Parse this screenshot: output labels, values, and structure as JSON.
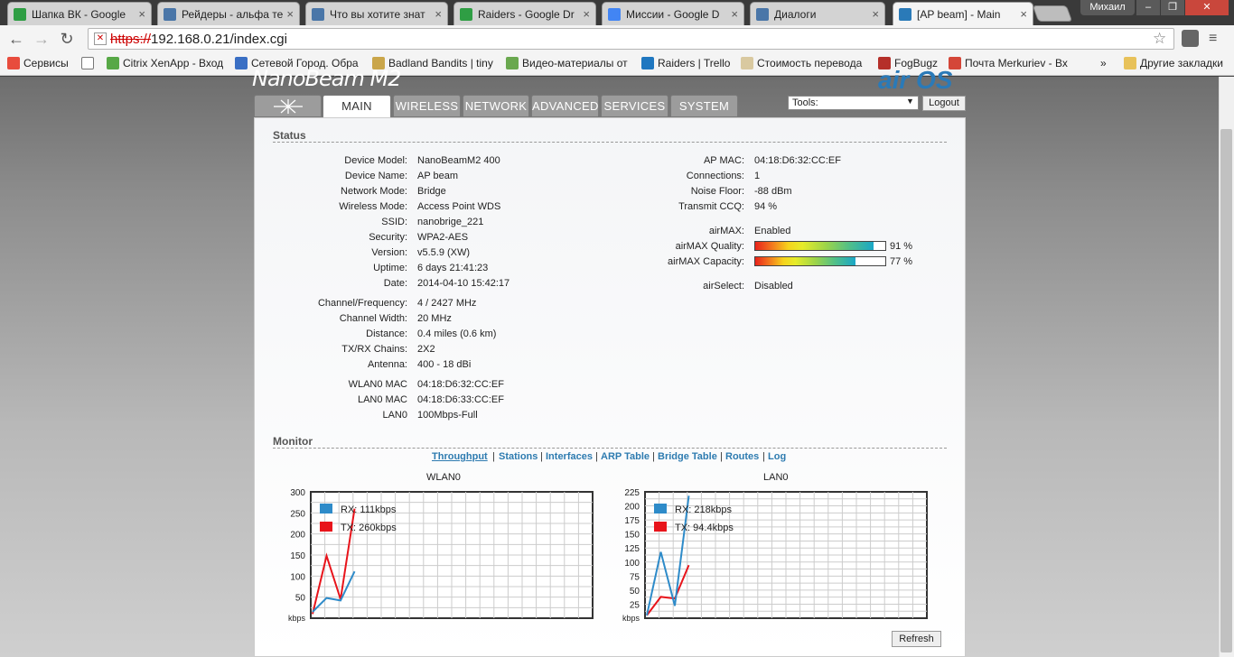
{
  "browser": {
    "tabs": [
      {
        "label": "Шапка ВК - Google",
        "icon": "google-drive-icon",
        "color": "#2f9e44"
      },
      {
        "label": "Рейдеры - альфа те",
        "icon": "vk-icon",
        "color": "#4a76a8"
      },
      {
        "label": "Что вы хотите знат",
        "icon": "vk-icon",
        "color": "#4a76a8"
      },
      {
        "label": "Raiders - Google Dr",
        "icon": "google-drive-icon",
        "color": "#2f9e44"
      },
      {
        "label": "Миссии - Google D",
        "icon": "google-docs-icon",
        "color": "#4285f4"
      },
      {
        "label": "Диалоги",
        "icon": "chat-icon",
        "color": "#4a76a8"
      },
      {
        "label": "[AP beam] - Main",
        "icon": "rss-icon",
        "color": "#2a7ab8"
      }
    ],
    "user": "Михаил",
    "url_scheme": "https://",
    "url_rest": "192.168.0.21/index.cgi",
    "bookmarks": [
      {
        "label": "Сервисы",
        "icon": "apps-icon"
      },
      {
        "label": "",
        "icon": "page-icon"
      },
      {
        "label": "Citrix XenApp - Вход",
        "icon": "citrix-icon"
      },
      {
        "label": "Сетевой Город. Обра",
        "icon": "network-city-icon"
      },
      {
        "label": "Badland Bandits | tiny",
        "icon": "badland-icon"
      },
      {
        "label": "Видео-материалы от",
        "icon": "h-icon"
      },
      {
        "label": "Raiders | Trello",
        "icon": "trello-icon"
      },
      {
        "label": "Стоимость перевода",
        "icon": "book-icon"
      },
      {
        "label": "FogBugz",
        "icon": "fogbugz-icon"
      },
      {
        "label": "Почта Merkuriev - Вх",
        "icon": "gmail-icon"
      }
    ],
    "bookmarks_more": "»",
    "other_bookmarks": "Другие закладки"
  },
  "device_ui": {
    "brand": "NanoBeam M2",
    "brand_right": "air OS",
    "tabs": [
      "MAIN",
      "WIRELESS",
      "NETWORK",
      "ADVANCED",
      "SERVICES",
      "SYSTEM"
    ],
    "tools_label": "Tools:",
    "logout": "Logout"
  },
  "status": {
    "title": "Status",
    "left": [
      {
        "label": "Device Model:",
        "value": "NanoBeamM2 400"
      },
      {
        "label": "Device Name:",
        "value": "AP beam"
      },
      {
        "label": "Network Mode:",
        "value": "Bridge"
      },
      {
        "label": "Wireless Mode:",
        "value": "Access Point WDS"
      },
      {
        "label": "SSID:",
        "value": "nanobrige_221"
      },
      {
        "label": "Security:",
        "value": "WPA2-AES"
      },
      {
        "label": "Version:",
        "value": "v5.5.9 (XW)"
      },
      {
        "label": "Uptime:",
        "value": "6 days 21:41:23"
      },
      {
        "label": "Date:",
        "value": "2014-04-10 15:42:17"
      },
      {
        "label": "Channel/Frequency:",
        "value": "4 / 2427 MHz"
      },
      {
        "label": "Channel Width:",
        "value": "20 MHz"
      },
      {
        "label": "Distance:",
        "value": "0.4 miles (0.6 km)"
      },
      {
        "label": "TX/RX Chains:",
        "value": "2X2"
      },
      {
        "label": "Antenna:",
        "value": "400 - 18 dBi"
      },
      {
        "label": "WLAN0 MAC",
        "value": "04:18:D6:32:CC:EF"
      },
      {
        "label": "LAN0 MAC",
        "value": "04:18:D6:33:CC:EF"
      },
      {
        "label": "LAN0",
        "value": "100Mbps-Full"
      }
    ],
    "right": [
      {
        "label": "AP MAC:",
        "value": "04:18:D6:32:CC:EF"
      },
      {
        "label": "Connections:",
        "value": "1"
      },
      {
        "label": "Noise Floor:",
        "value": "-88 dBm"
      },
      {
        "label": "Transmit CCQ:",
        "value": "94 %"
      },
      {
        "label": "airMAX:",
        "value": "Enabled"
      },
      {
        "label": "airSelect:",
        "value": "Disabled"
      }
    ],
    "airmax_quality": {
      "label": "airMAX Quality:",
      "value": "91 %",
      "level": 0.91
    },
    "airmax_capacity": {
      "label": "airMAX Capacity:",
      "value": "77 %",
      "level": 0.77
    }
  },
  "monitor": {
    "title": "Monitor",
    "links": [
      "Throughput",
      "Stations",
      "Interfaces",
      "ARP Table",
      "Bridge Table",
      "Routes",
      "Log"
    ],
    "refresh": "Refresh"
  },
  "chart_data": [
    {
      "type": "line",
      "title": "WLAN0",
      "ylabel": "kbps",
      "ylim": [
        0,
        300
      ],
      "yticks": [
        50,
        100,
        150,
        200,
        250,
        300
      ],
      "grid": true,
      "legend_position": "top-left",
      "x": [
        0,
        1,
        2,
        3
      ],
      "series": [
        {
          "name": "RX: 111kbps",
          "color": "#2e8bc9",
          "values": [
            15,
            48,
            42,
            111
          ]
        },
        {
          "name": "TX: 260kbps",
          "color": "#e8141b",
          "values": [
            10,
            148,
            45,
            260
          ]
        }
      ]
    },
    {
      "type": "line",
      "title": "LAN0",
      "ylabel": "kbps",
      "ylim": [
        0,
        225
      ],
      "yticks": [
        25,
        50,
        75,
        100,
        125,
        150,
        175,
        200,
        225
      ],
      "grid": true,
      "legend_position": "top-left",
      "x": [
        0,
        1,
        2,
        3
      ],
      "series": [
        {
          "name": "RX: 218kbps",
          "color": "#2e8bc9",
          "values": [
            5,
            118,
            22,
            218
          ]
        },
        {
          "name": "TX: 94.4kbps",
          "color": "#e8141b",
          "values": [
            5,
            38,
            35,
            94.4
          ]
        }
      ]
    }
  ]
}
